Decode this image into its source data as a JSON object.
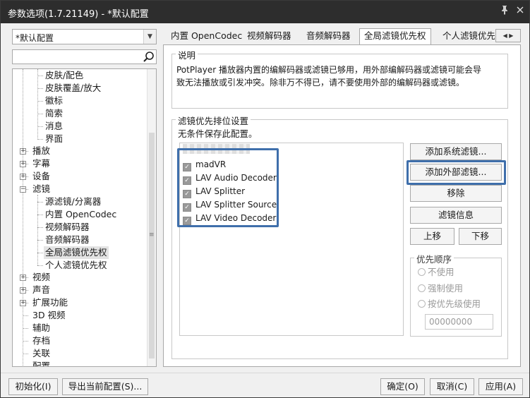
{
  "window": {
    "title": "参数选项(1.7.21149) - *默认配置"
  },
  "left": {
    "preset_value": "*默认配置",
    "search_value": "",
    "tree": [
      {
        "label": "皮肤/配色",
        "level": 2,
        "expander": ""
      },
      {
        "label": "皮肤覆盖/放大",
        "level": 2,
        "expander": ""
      },
      {
        "label": "徽标",
        "level": 2,
        "expander": ""
      },
      {
        "label": "简索",
        "level": 2,
        "expander": ""
      },
      {
        "label": "消息",
        "level": 2,
        "expander": ""
      },
      {
        "label": "界面",
        "level": 2,
        "expander": ""
      },
      {
        "label": "播放",
        "level": 1,
        "expander": "+"
      },
      {
        "label": "字幕",
        "level": 1,
        "expander": "+"
      },
      {
        "label": "设备",
        "level": 1,
        "expander": "+"
      },
      {
        "label": "滤镜",
        "level": 1,
        "expander": "-"
      },
      {
        "label": "源滤镜/分离器",
        "level": 2,
        "expander": ""
      },
      {
        "label": "内置 OpenCodec",
        "level": 2,
        "expander": ""
      },
      {
        "label": "视频解码器",
        "level": 2,
        "expander": ""
      },
      {
        "label": "音频解码器",
        "level": 2,
        "expander": ""
      },
      {
        "label": "全局滤镜优先权",
        "level": 2,
        "expander": "",
        "selected": true
      },
      {
        "label": "个人滤镜优先权",
        "level": 2,
        "expander": ""
      },
      {
        "label": "视频",
        "level": 1,
        "expander": "+"
      },
      {
        "label": "声音",
        "level": 1,
        "expander": "+"
      },
      {
        "label": "扩展功能",
        "level": 1,
        "expander": "+"
      },
      {
        "label": "3D 视频",
        "level": 1,
        "expander": ""
      },
      {
        "label": "辅助",
        "level": 1,
        "expander": ""
      },
      {
        "label": "存档",
        "level": 1,
        "expander": ""
      },
      {
        "label": "关联",
        "level": 1,
        "expander": ""
      },
      {
        "label": "配置",
        "level": 1,
        "expander": ""
      }
    ]
  },
  "tabs": [
    {
      "label": "内置 OpenCodec",
      "active": false
    },
    {
      "label": "视频解码器",
      "active": false
    },
    {
      "label": "音频解码器",
      "active": false
    },
    {
      "label": "全局滤镜优先权",
      "active": true
    },
    {
      "label": "个人滤镜优先",
      "active": false
    }
  ],
  "description": {
    "title": "说明",
    "text_line1": "PotPlayer 播放器内置的编解码器或滤镜已够用，用外部编解码器或滤镜可能会导",
    "text_line2": "致无法播放或引发冲突。除非万不得已，请不要使用外部的编解码器或滤镜。"
  },
  "filter_settings": {
    "title": "滤镜优先排位设置",
    "note": "无条件保存此配置。",
    "filters": [
      {
        "name": "madVR",
        "checked": true
      },
      {
        "name": "LAV Audio Decoder",
        "checked": true
      },
      {
        "name": "LAV Splitter",
        "checked": true
      },
      {
        "name": "LAV Splitter Source",
        "checked": true
      },
      {
        "name": "LAV Video Decoder",
        "checked": true
      }
    ],
    "buttons": {
      "add_system": "添加系统滤镜...",
      "add_external": "添加外部滤镜...",
      "remove": "移除",
      "filter_info": "滤镜信息",
      "move_up": "上移",
      "move_down": "下移"
    }
  },
  "priority": {
    "title": "优先顺序",
    "options": [
      "不使用",
      "强制使用",
      "按优先级使用"
    ],
    "value": "00000000"
  },
  "footer": {
    "init": "初始化(I)",
    "export": "导出当前配置(S)...",
    "ok": "确定(O)",
    "cancel": "取消(C)",
    "apply": "应用(A)"
  },
  "colors": {
    "titlebar": "#2d2d2d",
    "highlight": "#3f6fab",
    "panel": "#ffffff",
    "background": "#f0f0f0"
  }
}
